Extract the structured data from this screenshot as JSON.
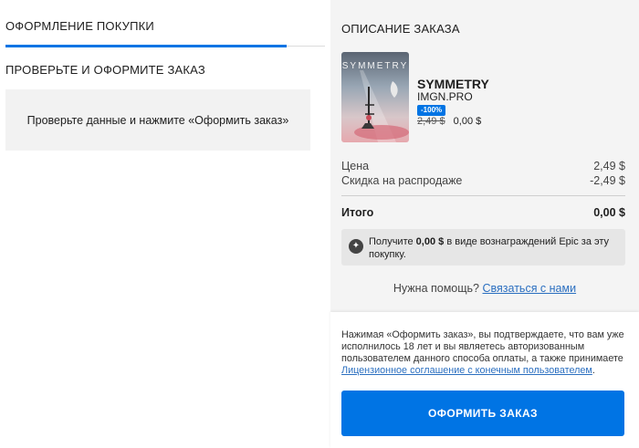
{
  "checkout": {
    "header": "ОФОРМЛЕНИЕ ПОКУПКИ",
    "progress_fraction": 0.88,
    "review_title": "ПРОВЕРЬТЕ И ОФОРМИТЕ ЗАКАЗ",
    "review_message": "Проверьте данные и нажмите «Оформить заказ»"
  },
  "summary": {
    "title": "ОПИСАНИЕ ЗАКАЗА",
    "product": {
      "cover_text": "SYMMETRY",
      "name": "SYMMETRY",
      "publisher": "IMGN.PRO",
      "discount_badge": "-100%",
      "old_price": "2,49 $",
      "new_price": "0,00 $"
    },
    "lines": {
      "price_label": "Цена",
      "price_value": "2,49 $",
      "sale_label": "Скидка на распродаже",
      "sale_value": "-2,49 $",
      "total_label": "Итого",
      "total_value": "0,00 $"
    },
    "reward": {
      "prefix": "Получите ",
      "amount": "0,00 $",
      "suffix": " в виде вознаграждений Epic за эту покупку."
    },
    "help": {
      "text": "Нужна помощь?",
      "link": "Связаться с нами"
    }
  },
  "legal": {
    "text": "Нажимая «Оформить заказ», вы подтверждаете, что вам уже исполнилось 18 лет и вы являетесь авторизованным пользователем данного способа оплаты, а также принимаете ",
    "link": "Лицензионное соглашение с конечным пользователем",
    "end": "."
  },
  "place_order_label": "ОФОРМИТЬ ЗАКАЗ",
  "colors": {
    "accent": "#0074e4",
    "link": "#2b6fc0",
    "panel": "#f4f4f4"
  }
}
